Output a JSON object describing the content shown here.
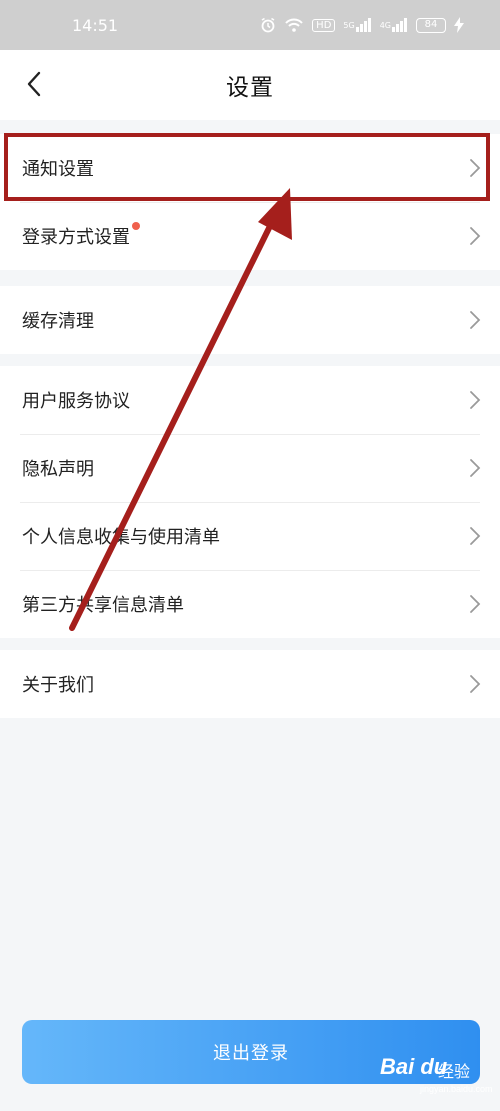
{
  "status_bar": {
    "time": "14:51",
    "hd_label": "HD",
    "signal1_label": "5G",
    "signal2_label": "4G",
    "battery": "84"
  },
  "header": {
    "title": "设置"
  },
  "groups": [
    {
      "items": [
        {
          "label": "通知设置"
        },
        {
          "label": "登录方式设置"
        }
      ]
    },
    {
      "items": [
        {
          "label": "缓存清理"
        }
      ]
    },
    {
      "items": [
        {
          "label": "用户服务协议"
        },
        {
          "label": "隐私声明"
        },
        {
          "label": "个人信息收集与使用清单"
        },
        {
          "label": "第三方共享信息清单"
        }
      ]
    },
    {
      "items": [
        {
          "label": "关于我们"
        }
      ]
    }
  ],
  "logout": {
    "label": "退出登录"
  },
  "watermark": {
    "logo": "Bai du",
    "text": "经验",
    "sub": "jingyan.baidu.com"
  },
  "colors": {
    "accent_start": "#65b7fa",
    "accent_end": "#2f8ff0",
    "annotation": "#a51f1c",
    "badge": "#f0604d"
  }
}
